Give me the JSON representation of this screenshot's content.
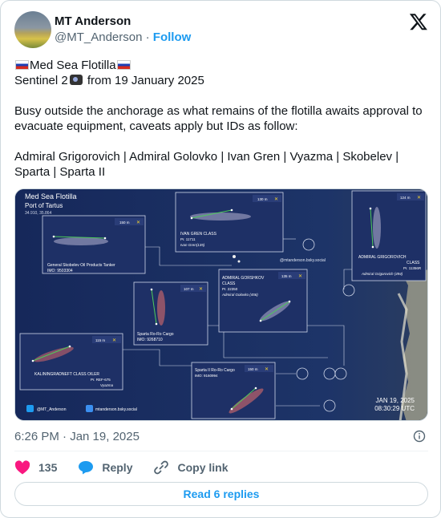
{
  "author": {
    "name": "MT Anderson",
    "handle": "@MT_Anderson",
    "separator": "·",
    "follow_label": "Follow"
  },
  "tweet": {
    "line1": "Med Sea Flotilla",
    "line2_prefix": "Sentinel 2",
    "line2_suffix": " from 19 January 2025",
    "paragraph2": "Busy outside the anchorage as what remains of the flotilla awaits approval to evacuate equipment, caveats apply but IDs as follow:",
    "paragraph3": "Admiral Grigorovich | Admiral Golovko | Ivan Gren | Vyazma | Skobelev | Sparta | Sparta II"
  },
  "image": {
    "title": "Med Sea Flotilla",
    "subtitle": "Port of Tartus",
    "coords": "34.910, 35.864",
    "date": "JAN 19, 2025",
    "time": "08:30:29 UTC",
    "credit_x": "@MT_Anderson",
    "credit_bsky": "mtanderson.bsky.social",
    "credit_mid": "@mtanderson.bsky.social",
    "insets": {
      "skobelev": {
        "name": "General Skobelev Oil Products Tanker",
        "imo": "IMO: 9503304",
        "scale": "150 m"
      },
      "ivan_gren": {
        "name": "IVAN GREN CLASS",
        "pr": "Pr. 11711",
        "ship": "Ivan Gren(135)",
        "scale": "130 m"
      },
      "grigorovich": {
        "name": "ADMIRAL GRIGOROVICH",
        "cls": "CLASS",
        "pr": "Pr. 11356R",
        "ship": "Admiral Grigorovich (494)",
        "scale": "124 m"
      },
      "gorshkov": {
        "name": "ADMIRAL GORSHKOV",
        "cls": "CLASS",
        "pr": "Pr. 22350",
        "ship": "Admiral Golovko (456)",
        "scale": "135 m"
      },
      "sparta": {
        "name": "Sparta Ro-Ro Cargo",
        "imo": "IMO: 9268710",
        "scale": "107 m"
      },
      "kaliningrad": {
        "name": "KALININGRADNEFT CLASS OILER",
        "pr": "Pr. REF-675",
        "ship": "Vyazma",
        "scale": "115 m"
      },
      "sparta2": {
        "name": "Sparta II Ro-Ro Cargo",
        "imo": "IMO: 9160994",
        "scale": "150 m"
      }
    }
  },
  "meta": {
    "timestamp": "6:26 PM · Jan 19, 2025"
  },
  "actions": {
    "likes": "135",
    "reply_label": "Reply",
    "copy_label": "Copy link",
    "read_replies_label": "Read 6 replies"
  },
  "colors": {
    "accent": "#1d9bf0",
    "like": "#f91880",
    "muted": "#536471",
    "sea": "#12204a"
  }
}
